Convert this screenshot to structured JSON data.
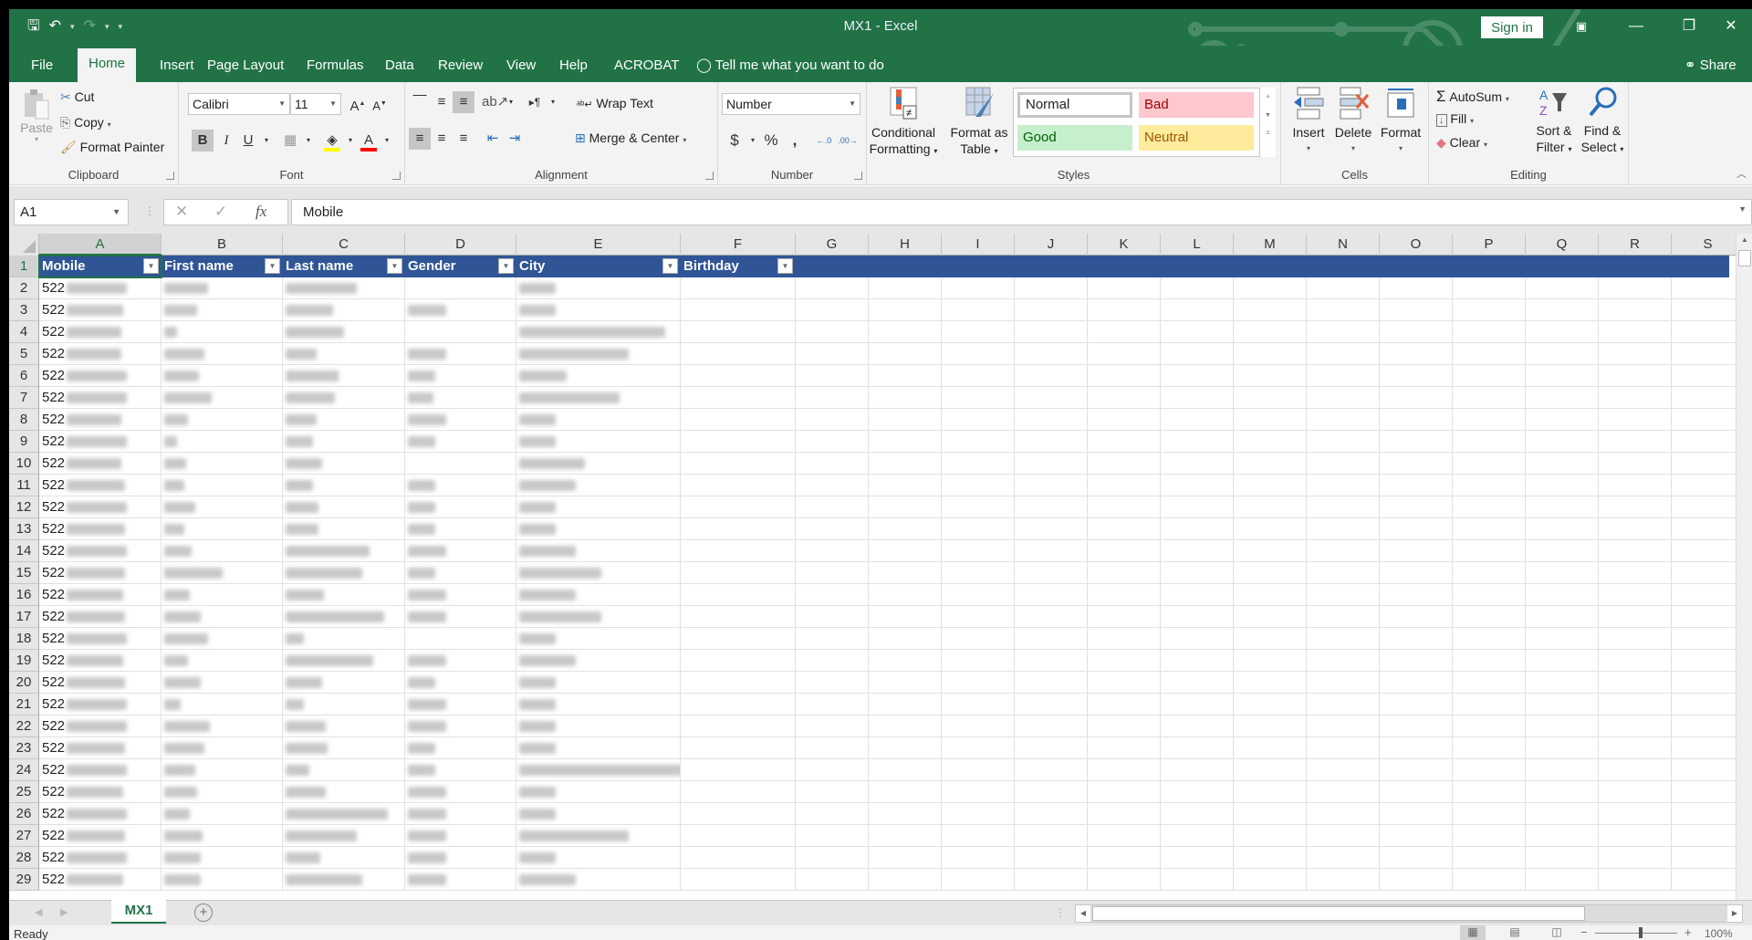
{
  "window": {
    "title": "MX1  -  Excel",
    "sign_in": "Sign in",
    "qat": {
      "save_icon": "save-icon",
      "undo_icon": "undo-icon",
      "redo_icon": "redo-icon",
      "customize_icon": "customize-qat-icon"
    },
    "controls": {
      "ribbon_display": "ribbon-display-icon",
      "minimize": "—",
      "restore": "❐",
      "close": "✕"
    }
  },
  "tabs": [
    {
      "label": "File"
    },
    {
      "label": "Home",
      "active": true
    },
    {
      "label": "Insert"
    },
    {
      "label": "Page Layout"
    },
    {
      "label": "Formulas"
    },
    {
      "label": "Data"
    },
    {
      "label": "Review"
    },
    {
      "label": "View"
    },
    {
      "label": "Help"
    },
    {
      "label": "ACROBAT"
    }
  ],
  "tell_me": "Tell me what you want to do",
  "share": "Share",
  "ribbon": {
    "clipboard": {
      "label": "Clipboard",
      "paste": "Paste",
      "cut": "Cut",
      "copy": "Copy",
      "format_painter": "Format Painter"
    },
    "font": {
      "label": "Font",
      "font_name": "Calibri",
      "font_size": "11",
      "bold": "B",
      "italic": "I",
      "underline": "U",
      "fill_color": "#ffff00",
      "font_color": "#ff0000"
    },
    "alignment": {
      "label": "Alignment",
      "wrap_text": "Wrap Text",
      "merge_center": "Merge & Center"
    },
    "number": {
      "label": "Number",
      "format": "Number",
      "currency": "$",
      "percent": "%",
      "comma": ","
    },
    "styles": {
      "label": "Styles",
      "conditional_formatting": [
        "Conditional",
        "Formatting"
      ],
      "format_as_table": [
        "Format as",
        "Table"
      ],
      "cells": [
        {
          "label": "Normal",
          "bg": "#ffffff",
          "fg": "#000000"
        },
        {
          "label": "Bad",
          "bg": "#ffc7ce",
          "fg": "#9c0006"
        },
        {
          "label": "Good",
          "bg": "#c6efce",
          "fg": "#006100"
        },
        {
          "label": "Neutral",
          "bg": "#ffeb9c",
          "fg": "#9c5700"
        }
      ]
    },
    "cells": {
      "label": "Cells",
      "insert": "Insert",
      "delete": "Delete",
      "format": "Format"
    },
    "editing": {
      "label": "Editing",
      "autosum": "AutoSum",
      "fill": "Fill",
      "clear": "Clear",
      "sort_filter": [
        "Sort &",
        "Filter"
      ],
      "find_select": [
        "Find &",
        "Select"
      ]
    }
  },
  "formula_bar": {
    "name_box": "A1",
    "cancel": "✕",
    "enter": "✓",
    "fx": "fx",
    "content": "Mobile"
  },
  "grid": {
    "columns": [
      "A",
      "B",
      "C",
      "D",
      "E",
      "F",
      "G",
      "H",
      "I",
      "J",
      "K",
      "L",
      "M",
      "N",
      "O",
      "P",
      "Q",
      "R",
      "S"
    ],
    "selected_column": "A",
    "header_row": [
      "Mobile",
      "First name",
      "Last name",
      "Gender",
      "City",
      "Birthday"
    ],
    "visible_prefix": "522",
    "redacted_note": "cell contents blurred",
    "rows": [
      2,
      3,
      4,
      5,
      6,
      7,
      8,
      9,
      10,
      11,
      12,
      13,
      14,
      15,
      16,
      17,
      18,
      19,
      20,
      21,
      22,
      23,
      24,
      25,
      26,
      27,
      28,
      29
    ]
  },
  "sheets": [
    {
      "name": "MX1",
      "active": true
    }
  ],
  "status": {
    "ready": "Ready",
    "zoom": "100%"
  },
  "accent": "#217346",
  "table_header_color": "#2f5597"
}
